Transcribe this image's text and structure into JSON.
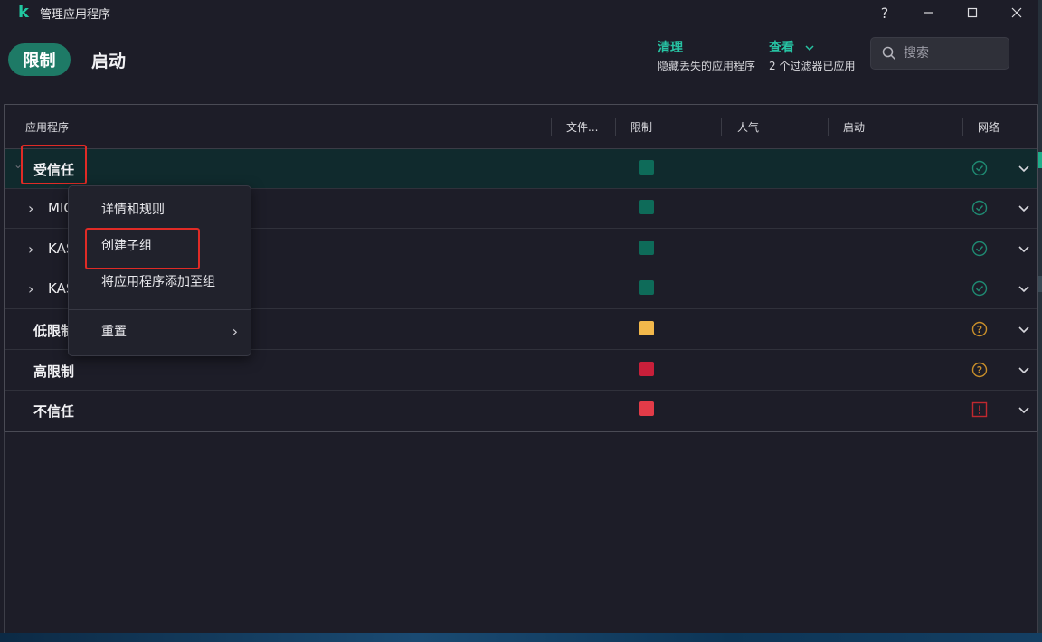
{
  "app": {
    "logo_letter": "k",
    "title": "管理应用程序"
  },
  "window_controls": {
    "help": "?",
    "minimize": "—",
    "maximize": "☐",
    "close": "✕"
  },
  "tabs": [
    {
      "label": "限制",
      "active": true
    },
    {
      "label": "启动",
      "active": false
    }
  ],
  "actions": {
    "cleanup": {
      "label": "清理",
      "sub": "隐藏丢失的应用程序"
    },
    "view": {
      "label": "查看",
      "sub": "2 个过滤器已应用"
    }
  },
  "search": {
    "placeholder": "搜索",
    "value": ""
  },
  "columns": [
    "应用程序",
    "文件...",
    "限制",
    "人气",
    "启动",
    "网络"
  ],
  "rows": [
    {
      "label": "受信任",
      "expanded": true,
      "level": 0,
      "color": "#0e6b59",
      "net": "check"
    },
    {
      "label": "MIC",
      "expanded": false,
      "level": 1,
      "color": "#0e6b59",
      "net": "check"
    },
    {
      "label": "KAS",
      "expanded": false,
      "level": 1,
      "color": "#0e6b59",
      "net": "check"
    },
    {
      "label": "KAS",
      "expanded": false,
      "level": 1,
      "color": "#0e6b59",
      "net": "check"
    },
    {
      "label": "低限制",
      "expanded": false,
      "level": 0,
      "color": "#f2b84b",
      "net": "question"
    },
    {
      "label": "高限制",
      "expanded": false,
      "level": 0,
      "color": "#c81f3a",
      "net": "question"
    },
    {
      "label": "不信任",
      "expanded": false,
      "level": 0,
      "color": "#e23b48",
      "net": "warning"
    }
  ],
  "context_menu": {
    "items": [
      {
        "label": "详情和规则"
      },
      {
        "label": "创建子组"
      },
      {
        "label": "将应用程序添加至组"
      },
      {
        "label": "重置",
        "submenu": true
      }
    ]
  },
  "colors": {
    "accent": "#27c3a3",
    "pill": "#1e7a66",
    "highlight_box": "#e02b26",
    "check": "#1f8a72",
    "question": "#c98f2a",
    "warning": "#c0282f"
  }
}
